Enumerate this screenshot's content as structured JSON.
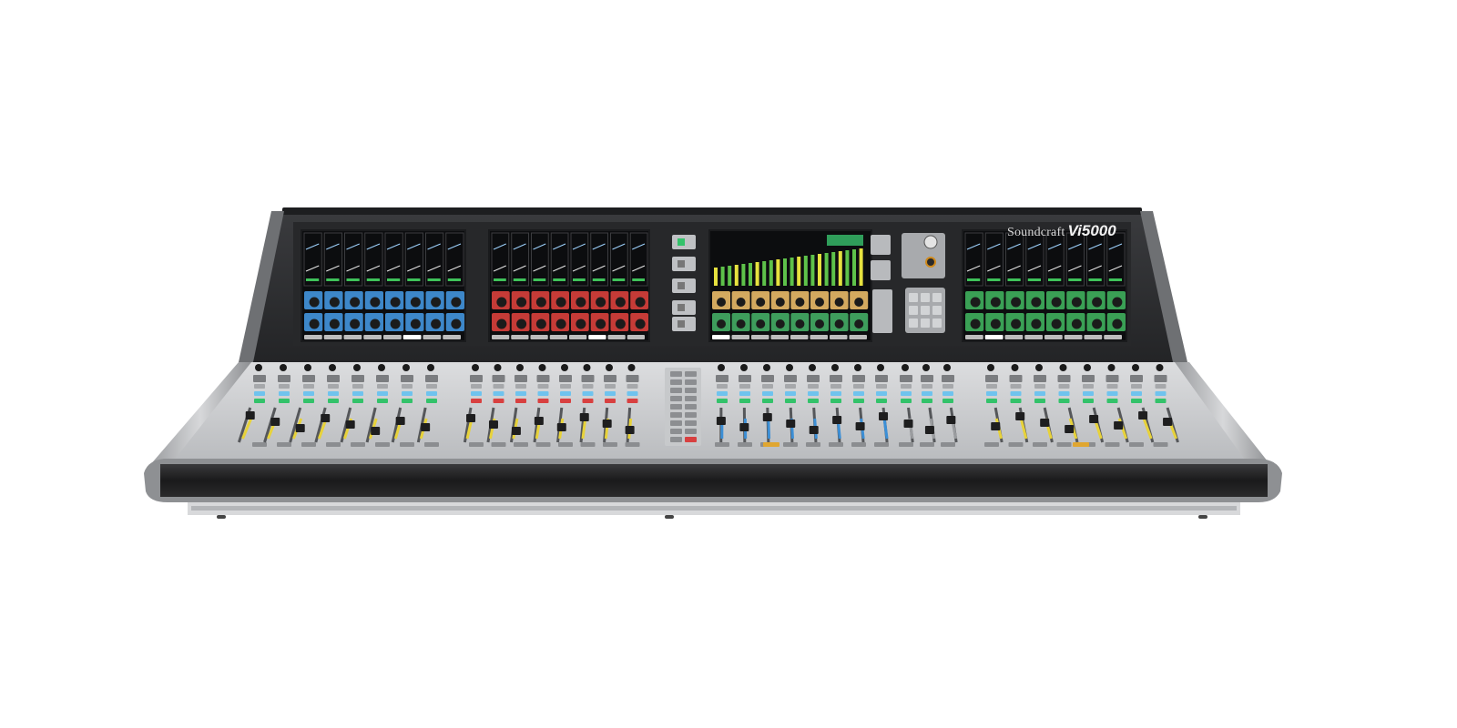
{
  "product": {
    "brand": "Soundcraft",
    "model": "Vi5000"
  },
  "colors": {
    "background": "#ffffff",
    "hood": "#2c2d2f",
    "bezel": "#3a3b3d",
    "surface": "#cfd1d3",
    "surface_dark": "#a7a9ac",
    "armrest": "#1c1c1d",
    "armrest_edge": "#8c8e91",
    "screen_bg": "#0c0d0f",
    "fader_yellow": "#e7d23a",
    "fader_blue": "#3c8fd6",
    "led_green": "#33c26a",
    "led_blue": "#6fc3ee",
    "led_red": "#d84040",
    "knob": "#1b1b1b"
  },
  "screens": [
    {
      "theme": "blue",
      "accent": "#3d87c9",
      "tabs": 8,
      "selected_tab": 5
    },
    {
      "theme": "red",
      "accent": "#c53b37",
      "tabs": 8,
      "selected_tab": 5
    },
    {
      "theme": "meters",
      "accent": "#d3a95f",
      "accent2": "#3e9d5c",
      "tabs": 8,
      "selected_tab": 0
    },
    {
      "theme": "green",
      "accent": "#3aa055",
      "tabs": 8,
      "selected_tab": 1
    }
  ],
  "surface_sections": [
    {
      "name": "input-bank-1",
      "channels": 8,
      "fader_color": "yellow"
    },
    {
      "name": "input-bank-2",
      "channels": 8,
      "fader_color": "yellow"
    },
    {
      "name": "vca-bank",
      "channels": 8,
      "fader_color": "blue"
    },
    {
      "name": "master-bank",
      "channels": 3,
      "fader_color": "gray"
    },
    {
      "name": "input-bank-3",
      "channels": 8,
      "fader_color": "yellow"
    }
  ]
}
